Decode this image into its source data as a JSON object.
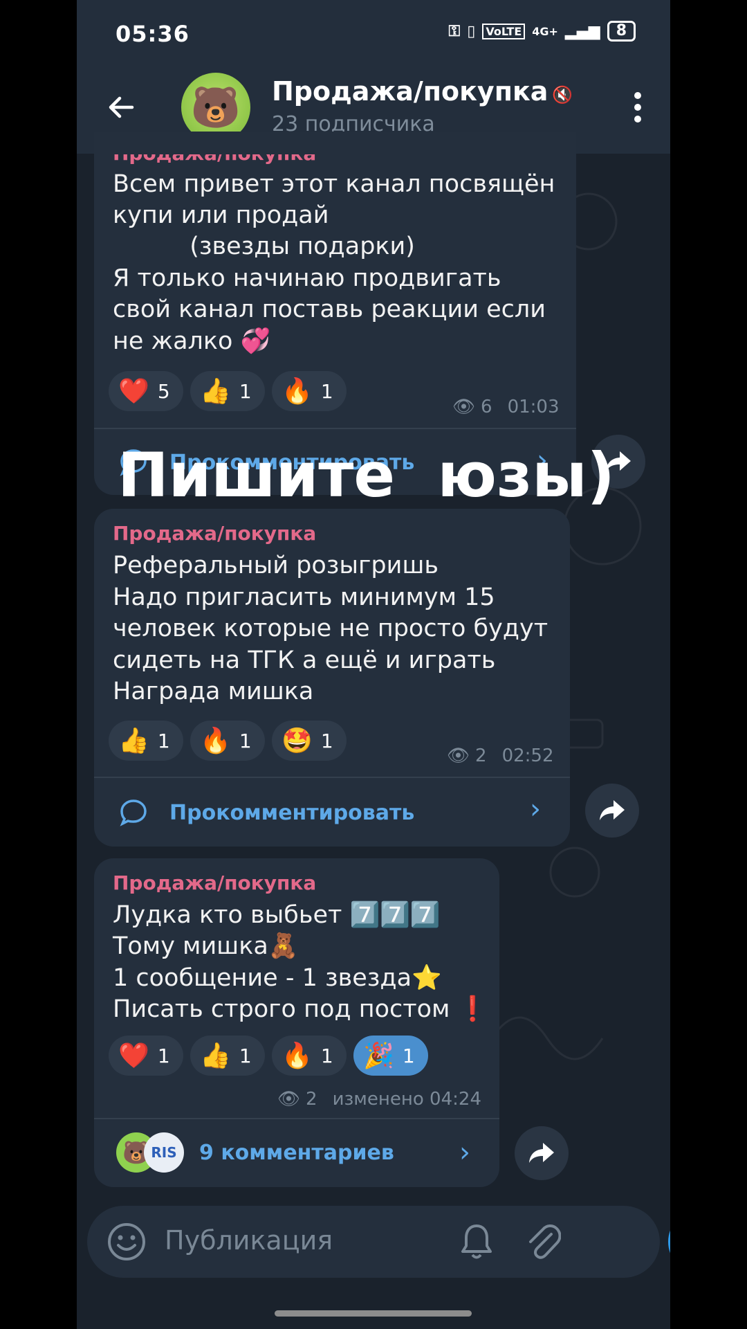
{
  "status": {
    "time": "05:36",
    "net_label": "VoLTE",
    "net_gen": "4G+",
    "battery": "8"
  },
  "header": {
    "title": "Продажа/покупка",
    "subscribers": "23 подписчика",
    "avatar_emoji": "🐻"
  },
  "overlay_text": "Пишите  юзы)",
  "posts": [
    {
      "sender": "Продажа/покупка",
      "text_lines": [
        "Всем привет этот канал посвящён",
        "купи или продай",
        "          (звезды подарки)",
        "Я только начинаю продвигать",
        "свой канал поставь реакции если",
        "не жалко 💞"
      ],
      "reactions": [
        {
          "emoji": "❤️",
          "count": "5"
        },
        {
          "emoji": "👍",
          "count": "1"
        },
        {
          "emoji": "🔥",
          "count": "1"
        }
      ],
      "views": "6",
      "time": "01:03",
      "comment_label": "Прокомментировать"
    },
    {
      "sender": "Продажа/покупка",
      "text_lines": [
        "Реферальный розыгришь",
        "Надо пригласить минимум 15",
        "человек которые не просто будут",
        "сидеть на ТГК а ещё и играть",
        "Награда мишка"
      ],
      "reactions": [
        {
          "emoji": "👍",
          "count": "1"
        },
        {
          "emoji": "🔥",
          "count": "1"
        },
        {
          "emoji": "🤩",
          "count": "1"
        }
      ],
      "views": "2",
      "time": "02:52",
      "comment_label": "Прокомментировать"
    },
    {
      "sender": "Продажа/покупка",
      "text_lines": [
        "Лудка кто выбьет 7️⃣7️⃣7️⃣",
        "Тому мишка🧸",
        "1 сообщение - 1 звезда⭐",
        "Писать строго под постом ❗"
      ],
      "reactions": [
        {
          "emoji": "❤️",
          "count": "1"
        },
        {
          "emoji": "👍",
          "count": "1"
        },
        {
          "emoji": "🔥",
          "count": "1"
        },
        {
          "emoji": "🎉",
          "count": "1"
        }
      ],
      "views": "2",
      "time": "изменено 04:24",
      "comment_label": "9 комментариев",
      "commenter_avatars": [
        "🐻",
        "RIS"
      ]
    }
  ],
  "input": {
    "placeholder": "Публикация"
  },
  "colors": {
    "accent": "#5ea9e8",
    "sender": "#e3698a",
    "bubble": "#242f3d",
    "background": "#1a222c"
  }
}
